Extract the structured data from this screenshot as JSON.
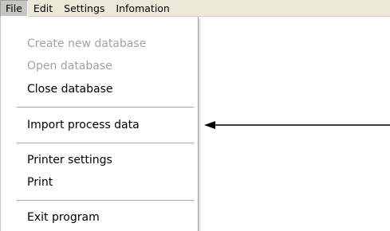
{
  "menubar": {
    "items": [
      {
        "label": "File"
      },
      {
        "label": "Edit"
      },
      {
        "label": "Settings"
      },
      {
        "label": "Infomation"
      }
    ]
  },
  "file_menu": {
    "create_new_database": "Create new database",
    "open_database": "Open database",
    "close_database": "Close database",
    "import_process_data": "Import process data",
    "printer_settings": "Printer settings",
    "print": "Print",
    "exit_program": "Exit program"
  },
  "colors": {
    "menubar_bg": "#ece9d8",
    "disabled_text": "#a3a3a3",
    "arrow": "#000000"
  },
  "icons": {
    "annotation_arrow": "left-arrow"
  }
}
